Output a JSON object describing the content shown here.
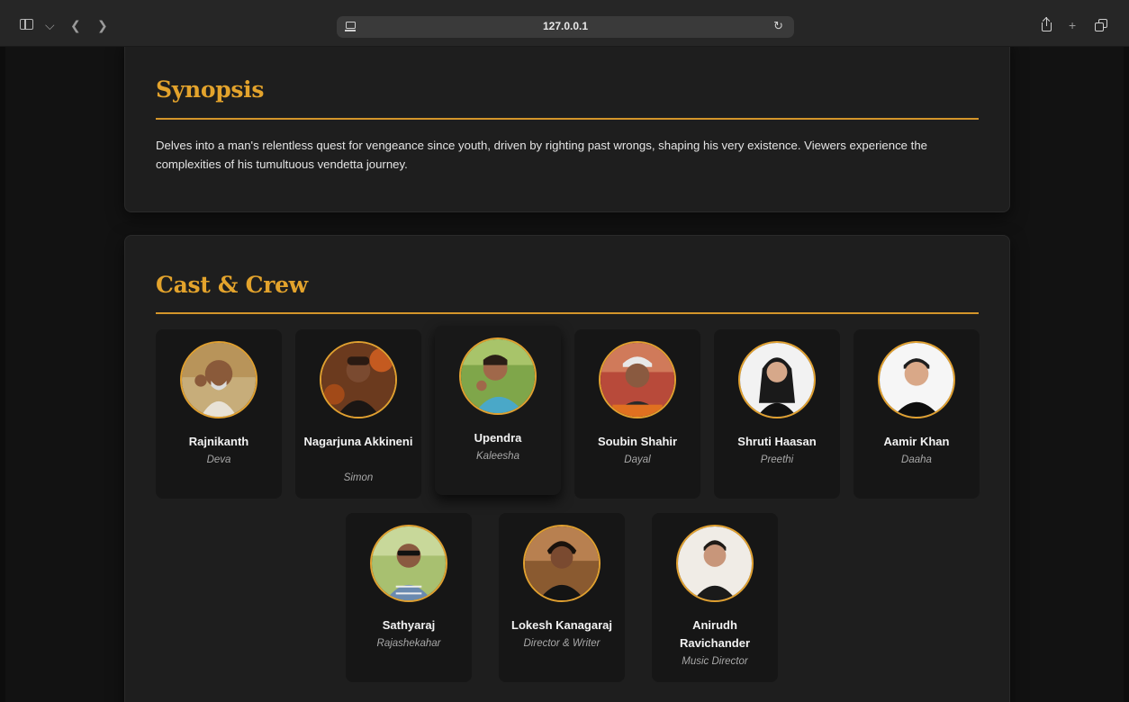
{
  "browser": {
    "url": "127.0.0.1",
    "icons": {
      "sidebar": "sidebar-icon",
      "dropdown": "chevron-down-icon",
      "back": "chevron-left-icon",
      "forward": "chevron-right-icon",
      "page": "page-icon",
      "reload": "reload-icon",
      "share": "share-icon",
      "new_tab": "plus-icon",
      "tabs": "tabs-overview-icon"
    }
  },
  "theme": {
    "accent": "#e3a32c",
    "card_bg": "#1e1e1e",
    "tile_bg": "#161616"
  },
  "synopsis": {
    "title": "Synopsis",
    "text": "Delves into a man's relentless quest for vengeance since youth, driven by righting past wrongs, shaping his very existence. Viewers experience the complexities of his tumultuous vendetta journey."
  },
  "cast": {
    "title": "Cast & Crew",
    "members": [
      {
        "name": "Rajnikanth",
        "role": "Deva"
      },
      {
        "name": "Nagarjuna Akkineni",
        "role": "Simon"
      },
      {
        "name": "Upendra",
        "role": "Kaleesha"
      },
      {
        "name": "Soubin Shahir",
        "role": "Dayal"
      },
      {
        "name": "Shruti Haasan",
        "role": "Preethi"
      },
      {
        "name": "Aamir Khan",
        "role": "Daaha"
      },
      {
        "name": "Sathyaraj",
        "role": "Rajashekahar"
      },
      {
        "name": "Lokesh Kanagaraj",
        "role": "Director & Writer"
      },
      {
        "name": "Anirudh Ravichander",
        "role": "Music Director"
      }
    ]
  }
}
